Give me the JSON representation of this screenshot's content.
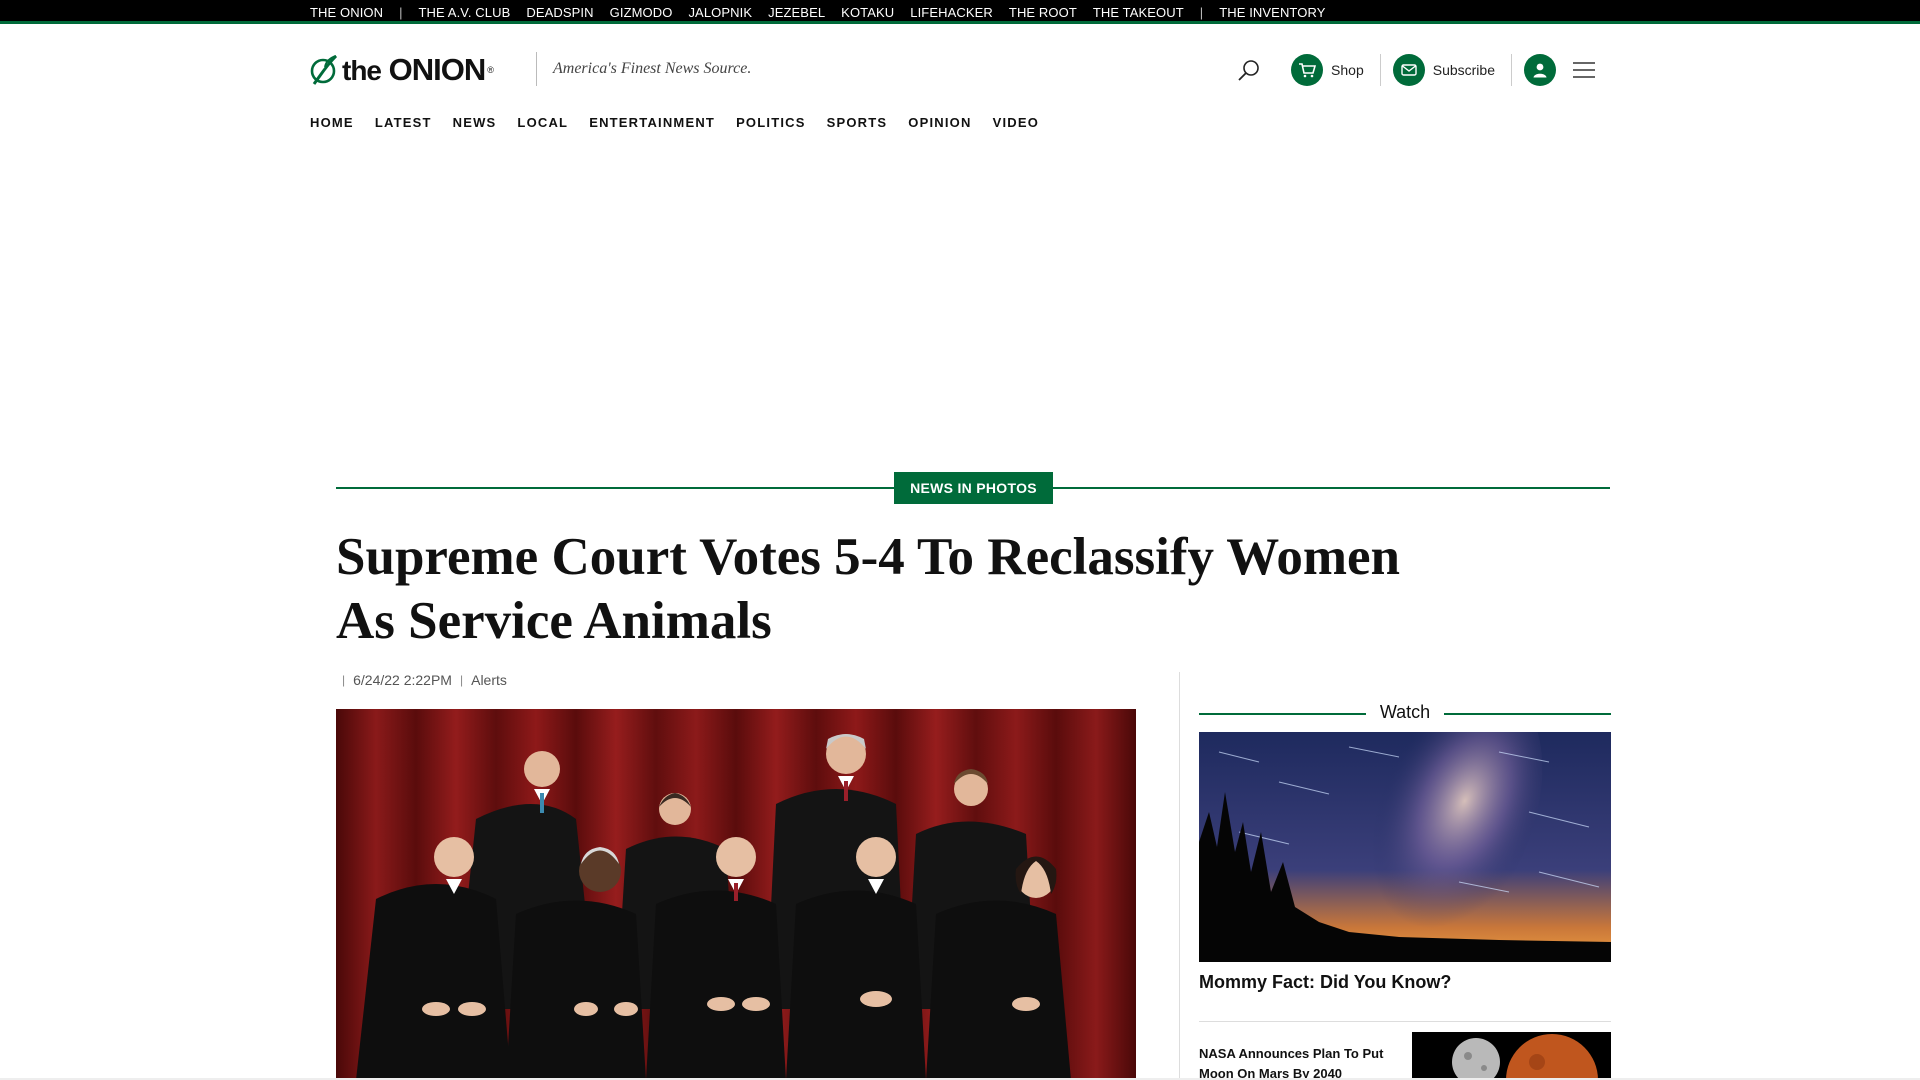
{
  "network_bar": {
    "sites": [
      "THE ONION",
      "THE A.V. CLUB",
      "DEADSPIN",
      "GIZMODO",
      "JALOPNIK",
      "JEZEBEL",
      "KOTAKU",
      "LIFEHACKER",
      "THE ROOT",
      "THE TAKEOUT",
      "THE INVENTORY"
    ],
    "separator": "|"
  },
  "header": {
    "logo_the": "the",
    "logo_onion": "ONION",
    "logo_reg": "®",
    "tagline": "America's Finest News Source.",
    "shop_label": "Shop",
    "subscribe_label": "Subscribe"
  },
  "nav": {
    "items": [
      "HOME",
      "LATEST",
      "NEWS",
      "LOCAL",
      "ENTERTAINMENT",
      "POLITICS",
      "SPORTS",
      "OPINION",
      "VIDEO"
    ]
  },
  "article": {
    "category": "NEWS IN PHOTOS",
    "headline": "Supreme Court Votes 5-4 To Reclassify Women As Service Animals",
    "timestamp": "6/24/22 2:22PM",
    "tag": "Alerts"
  },
  "sidebar": {
    "watch_title": "Watch",
    "watch_caption": "Mommy Fact: Did You Know?",
    "story_title": "NASA Announces Plan To Put Moon On Mars By 2040"
  },
  "colors": {
    "brand_green": "#006B3A",
    "bar_black": "#000000"
  },
  "icons": [
    "leaf-logo-icon",
    "search-icon",
    "cart-icon",
    "mail-icon",
    "user-icon",
    "hamburger-icon"
  ]
}
